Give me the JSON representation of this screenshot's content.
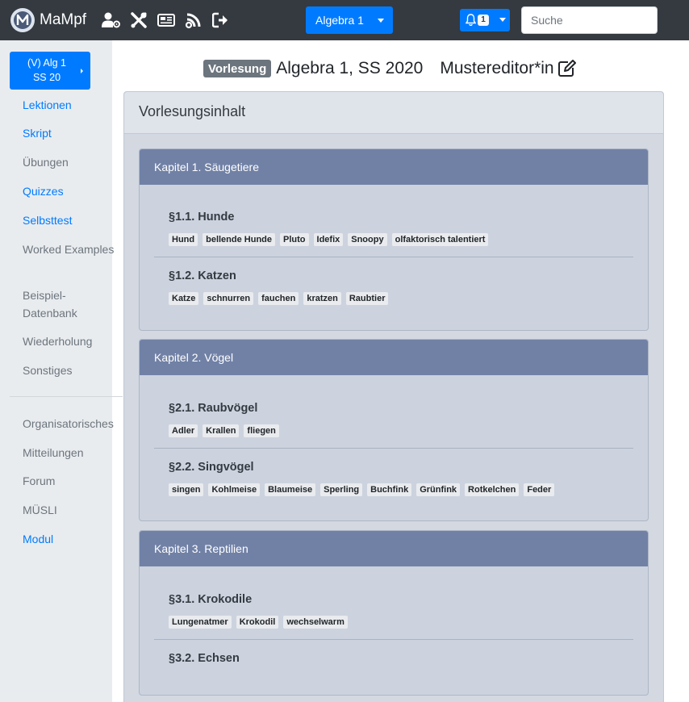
{
  "navbar": {
    "brand": "MaMpf",
    "lecture_dropdown": "Algebra 1",
    "notification_count": "1",
    "search_placeholder": "Suche"
  },
  "sidebar": {
    "course_button_line1": "(V) Alg 1",
    "course_button_line2": "SS 20",
    "items": [
      {
        "label": "Lektionen",
        "type": "link"
      },
      {
        "label": "Skript",
        "type": "link"
      },
      {
        "label": "Übungen",
        "type": "muted"
      },
      {
        "label": "Quizzes",
        "type": "link"
      },
      {
        "label": "Selbsttest",
        "type": "link"
      },
      {
        "label": "Worked Examples",
        "type": "muted"
      },
      {
        "label": "Beispiel-",
        "type": "muted"
      },
      {
        "label": "Datenbank",
        "type": "muted"
      },
      {
        "label": "Wiederholung",
        "type": "muted"
      },
      {
        "label": "Sonstiges",
        "type": "muted"
      },
      {
        "label": "Organisatorisches",
        "type": "muted"
      },
      {
        "label": "Mitteilungen",
        "type": "muted"
      },
      {
        "label": "Forum",
        "type": "muted"
      },
      {
        "label": "MÜSLI",
        "type": "muted"
      },
      {
        "label": "Modul",
        "type": "link"
      }
    ]
  },
  "page": {
    "badge": "Vorlesung",
    "title": "Algebra 1, SS 2020",
    "editor": "Mustereditor*in"
  },
  "content": {
    "header": "Vorlesungsinhalt",
    "chapters": [
      {
        "title": "Kapitel 1. Säugetiere",
        "sections": [
          {
            "title": "§1.1. Hunde",
            "tags": [
              "Hund",
              "bellende Hunde",
              "Pluto",
              "Idefix",
              "Snoopy",
              "olfaktorisch talentiert"
            ]
          },
          {
            "title": "§1.2. Katzen",
            "tags": [
              "Katze",
              "schnurren",
              "fauchen",
              "kratzen",
              "Raubtier"
            ]
          }
        ]
      },
      {
        "title": "Kapitel 2. Vögel",
        "sections": [
          {
            "title": "§2.1. Raubvögel",
            "tags": [
              "Adler",
              "Krallen",
              "fliegen"
            ]
          },
          {
            "title": "§2.2. Singvögel",
            "tags": [
              "singen",
              "Kohlmeise",
              "Blaumeise",
              "Sperling",
              "Buchfink",
              "Grünfink",
              "Rotkelchen",
              "Feder"
            ]
          }
        ]
      },
      {
        "title": "Kapitel 3. Reptilien",
        "sections": [
          {
            "title": "§3.1. Krokodile",
            "tags": [
              "Lungenatmer",
              "Krokodil",
              "wechselwarm"
            ]
          },
          {
            "title": "§3.2. Echsen",
            "tags": []
          }
        ]
      }
    ]
  },
  "colors": {
    "navbar": "#343a40",
    "primary": "#007bff",
    "chapter_header": "#7181a6",
    "chapter_body": "#ccd3df",
    "sidebar": "#e9ecef"
  }
}
